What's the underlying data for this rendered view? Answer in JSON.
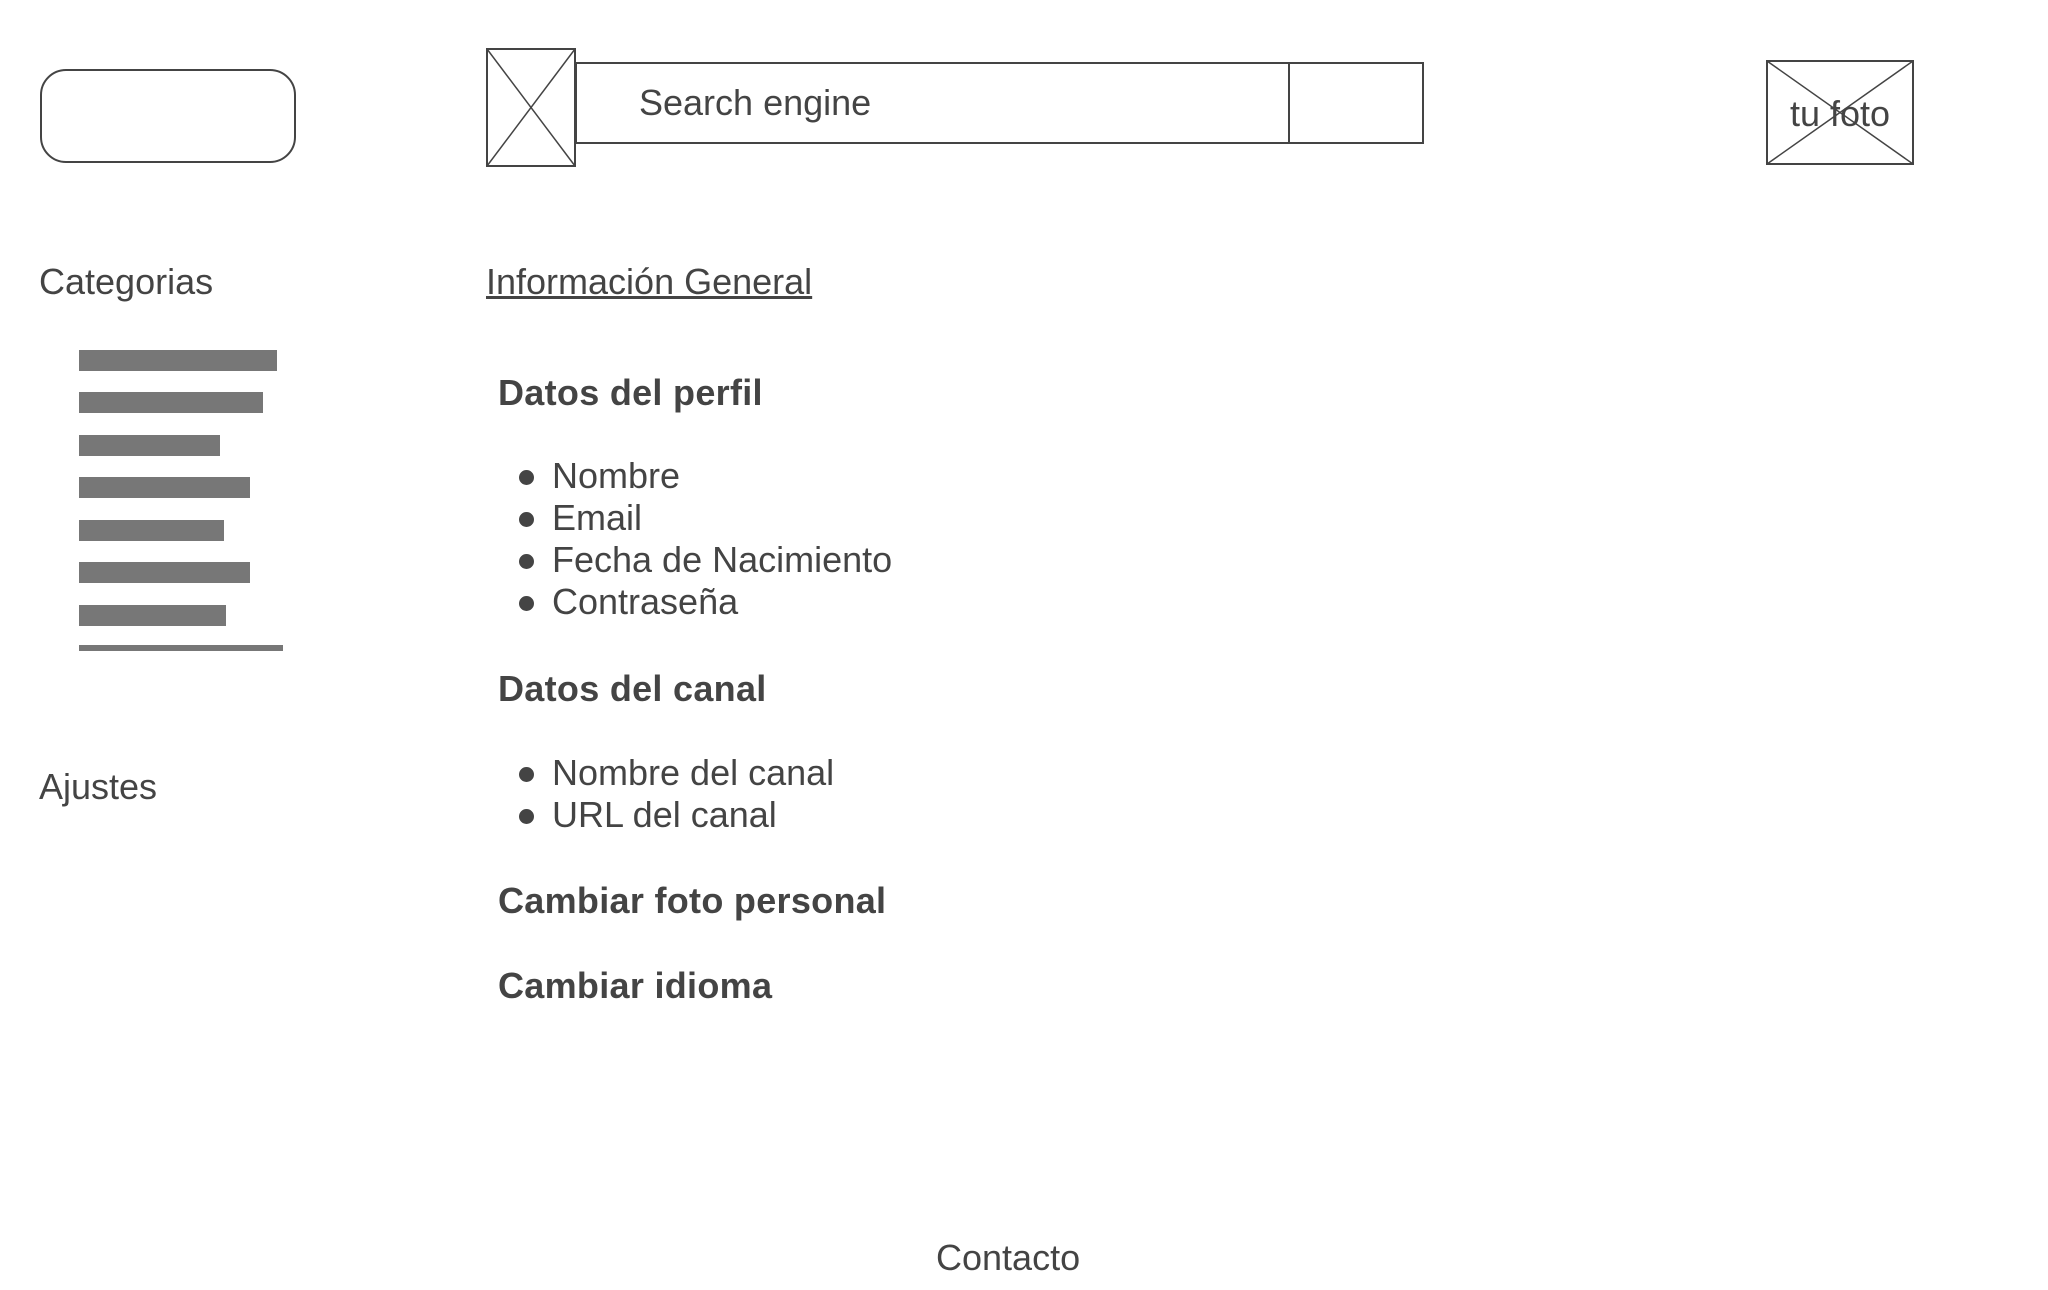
{
  "header": {
    "search": {
      "placeholder": "Search engine"
    },
    "profile_photo_label": "tu foto"
  },
  "sidebar": {
    "categories_title": "Categorias",
    "category_count": 7,
    "settings_title": "Ajustes"
  },
  "main": {
    "section_link": "Información General",
    "profile_heading": "Datos del perfil",
    "profile_items": [
      "Nombre",
      "Email",
      "Fecha de Nacimiento",
      "Contraseña"
    ],
    "channel_heading": "Datos del canal",
    "channel_items": [
      "Nombre del canal",
      "URL del canal"
    ],
    "change_photo": "Cambiar foto personal",
    "change_language": "Cambiar idioma"
  },
  "footer": {
    "contact": "Contacto"
  }
}
